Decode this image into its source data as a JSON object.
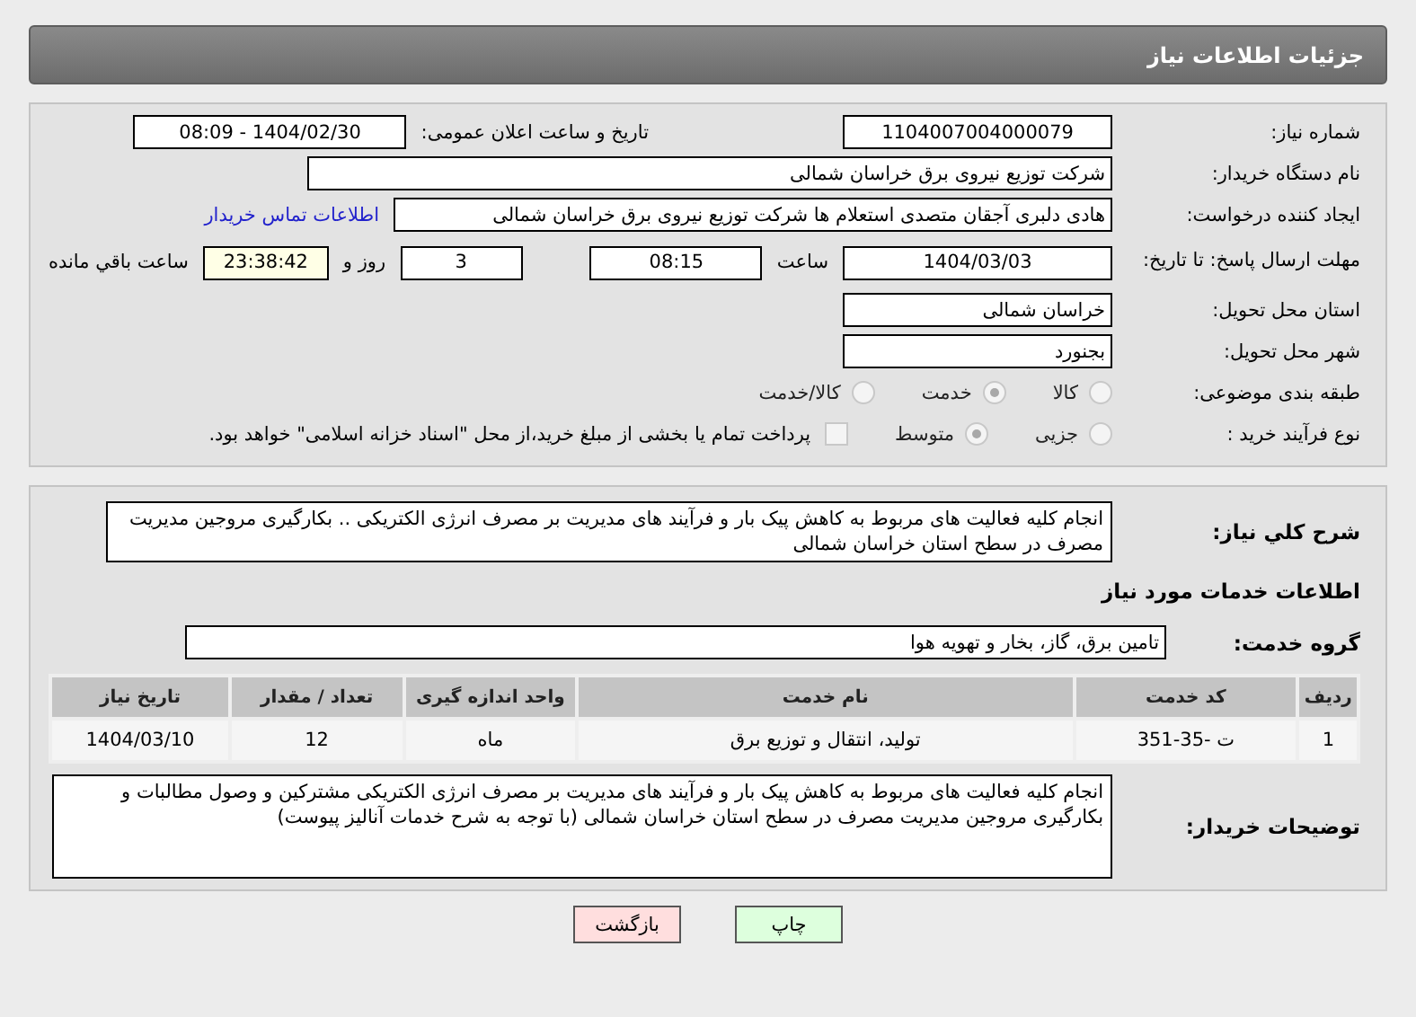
{
  "header": {
    "title": "جزئیات اطلاعات نیاز"
  },
  "need_number": {
    "label": "شماره نیاز:",
    "value": "1104007004000079"
  },
  "announce": {
    "label": "تاریخ و ساعت اعلان عمومی:",
    "value": "1404/02/30 - 08:09"
  },
  "buyer": {
    "label": "نام دستگاه خریدار:",
    "value": "شرکت توزیع نیروی برق خراسان شمالی"
  },
  "creator": {
    "label": "ایجاد کننده درخواست:",
    "value": "هادی دلبری آجقان متصدی استعلام ها شرکت توزیع نیروی برق خراسان شمالی",
    "link": "اطلاعات تماس خریدار"
  },
  "deadline": {
    "label": "مهلت ارسال پاسخ: تا تاریخ:",
    "date": "1404/03/03",
    "time_label": "ساعت",
    "time": "08:15",
    "days": "3",
    "days_label": "روز و",
    "remaining": "23:38:42",
    "remaining_label": "ساعت باقي مانده"
  },
  "province": {
    "label": "استان محل تحویل:",
    "value": "خراسان شمالی"
  },
  "city": {
    "label": "شهر محل تحویل:",
    "value": "بجنورد"
  },
  "category": {
    "label": "طبقه بندی موضوعی:",
    "options": [
      {
        "label": "کالا",
        "selected": false
      },
      {
        "label": "خدمت",
        "selected": true
      },
      {
        "label": "کالا/خدمت",
        "selected": false
      }
    ]
  },
  "purchase_type": {
    "label": "نوع فرآیند خرید :",
    "options": [
      {
        "label": "جزیی",
        "selected": false
      },
      {
        "label": "متوسط",
        "selected": true
      }
    ],
    "treasury": {
      "checked": false,
      "label": "پرداخت تمام یا بخشی از مبلغ خرید،از محل \"اسناد خزانه اسلامی\" خواهد بود."
    }
  },
  "summary": {
    "label": "شرح کلي نیاز:",
    "value": "انجام کلیه فعالیت های مربوط به کاهش پیک بار و فرآیند های مدیریت بر مصرف انرژی الکتریکی .. بکارگیری مروجین مدیریت مصرف در سطح استان خراسان شمالی"
  },
  "services_title": "اطلاعات خدمات مورد نیاز",
  "service_group": {
    "label": "گروه خدمت:",
    "value": "تامین برق، گاز، بخار و تهویه هوا"
  },
  "table": {
    "columns": [
      "ردیف",
      "کد خدمت",
      "نام خدمت",
      "واحد اندازه گیری",
      "تعداد / مقدار",
      "تاریخ نیاز"
    ],
    "rows": [
      [
        "1",
        "ت -35-351",
        "تولید، انتقال و توزیع برق",
        "ماه",
        "12",
        "1404/03/10"
      ]
    ]
  },
  "buyer_notes": {
    "label": "توضیحات خریدار:",
    "value": "انجام کلیه فعالیت های مربوط به کاهش پیک بار و فرآیند های مدیریت بر مصرف انرژی الکتریکی مشترکین و وصول مطالبات و بکارگیری مروجین مدیریت مصرف در سطح استان خراسان شمالی (با توجه به شرح خدمات آنالیز پیوست)"
  },
  "buttons": [
    {
      "label": "چاپ",
      "kind": "print"
    },
    {
      "label": "بازگشت",
      "kind": "back"
    }
  ]
}
